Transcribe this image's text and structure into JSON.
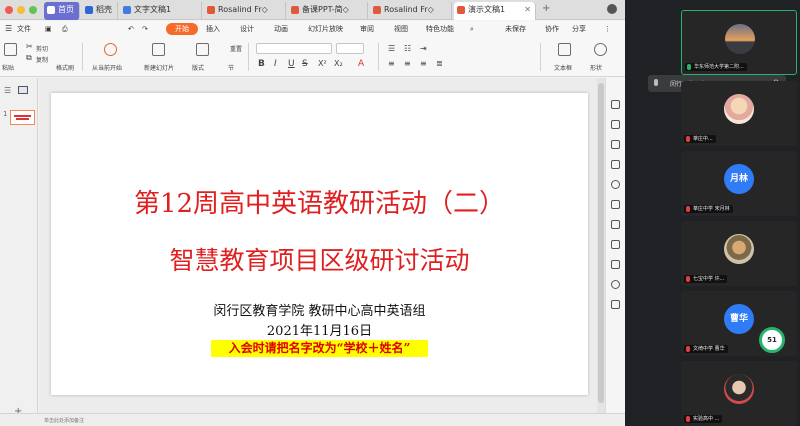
{
  "tabs": [
    {
      "label": "首页",
      "icon_color": "#d03a2a"
    },
    {
      "label": "稻壳",
      "icon_color": "#2b67d6"
    },
    {
      "label": "文字文稿1",
      "icon_color": "#3f7be0"
    },
    {
      "label": "Rosalind Fr◇",
      "icon_color": "#e0593a"
    },
    {
      "label": "备课PPT-简◇",
      "icon_color": "#e0593a"
    },
    {
      "label": "Rosalind Fr◇",
      "icon_color": "#e0593a"
    },
    {
      "label": "演示文稿1",
      "icon_color": "#e0593a"
    }
  ],
  "menubar": {
    "file": "文件",
    "items": [
      "开始",
      "插入",
      "设计",
      "动画",
      "幻灯片放映",
      "审阅",
      "视图",
      "特色功能"
    ],
    "right": [
      "未保存",
      "协作",
      "分享"
    ]
  },
  "ribbon": {
    "paste": "粘贴",
    "cut": "剪切",
    "copy": "复制",
    "format_painter": "格式刷",
    "new_slide": "从当前开始",
    "layout": "新建幻灯片",
    "format": "版式",
    "section": "节",
    "reset": "重置",
    "textbox": "文本框",
    "shape": "形状"
  },
  "left_panel": {
    "slide_number": "1",
    "add": "+"
  },
  "slide": {
    "title": "第12周高中英语教研活动（二）",
    "subtitle": "智慧教育项目区级研讨活动",
    "org": "闵行区教育学院 教研中心高中英语组",
    "date": "2021年11月16日",
    "notice": "入会时请把名字改为“学校＋姓名”"
  },
  "status": {
    "notes": "单击此处添加备注"
  },
  "meeting": {
    "tooltip": "闵行区第五十...",
    "participants": [
      {
        "name": "华东师范大学第二附...",
        "avatar_type": "photo"
      },
      {
        "name": "莘庄中...",
        "avatar_type": "photo"
      },
      {
        "name": "莘庄中学 宋月林",
        "avatar_type": "text",
        "avatar_text": "月林",
        "avatar_color": "#2f7cf6"
      },
      {
        "name": "七宝中学 许...",
        "avatar_type": "photo"
      },
      {
        "name": "文绮中学 曹华",
        "avatar_type": "text",
        "avatar_text": "曹华",
        "avatar_color": "#2f7cf6"
      },
      {
        "name": "实验高中 ...",
        "avatar_type": "photo"
      }
    ],
    "network": "51"
  }
}
